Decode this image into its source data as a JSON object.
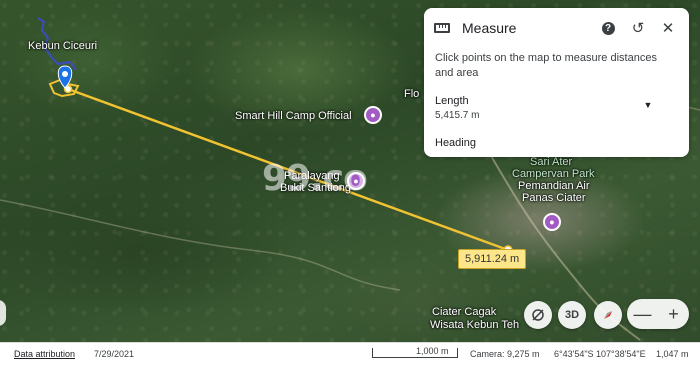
{
  "map": {
    "labels": {
      "kebun_ciceuri": "Kebun Ciceuri",
      "smart_hill": "Smart Hill Camp Official",
      "paralayang_line1": "Paralayang",
      "paralayang_line2": "Bukit Santiong",
      "sari_ater": "Sari Ater",
      "campervan": "Campervan Park",
      "pemandian_line1": "Pemandian Air",
      "pemandian_line2": "Panas Ciater",
      "ciater_line1": "Ciater Cagak",
      "ciater_line2": "Wisata Kebun Teh",
      "flo_partial": "Flo"
    },
    "watermark": "99.co",
    "measure_tag": "5,911.24 m",
    "line_color": "#f1c232"
  },
  "panel": {
    "title": "Measure",
    "help_icon": "?",
    "undo_icon": "↺",
    "close_icon": "✕",
    "description": "Click points on the map to measure distances and area",
    "length_label": "Length",
    "length_value": "5,415.7 m",
    "dropdown_icon": "▼",
    "heading_label": "Heading"
  },
  "controls": {
    "button_3d": "3D",
    "zoom_out": "—",
    "zoom_in": "+"
  },
  "statusbar": {
    "data_attribution": "Data attribution",
    "date": "7/29/2021",
    "scale": "1,000 m",
    "camera": "Camera: 9,275 m",
    "coords": "6°43'54\"S 107°38'54\"E",
    "elevation": "1,047 m"
  }
}
